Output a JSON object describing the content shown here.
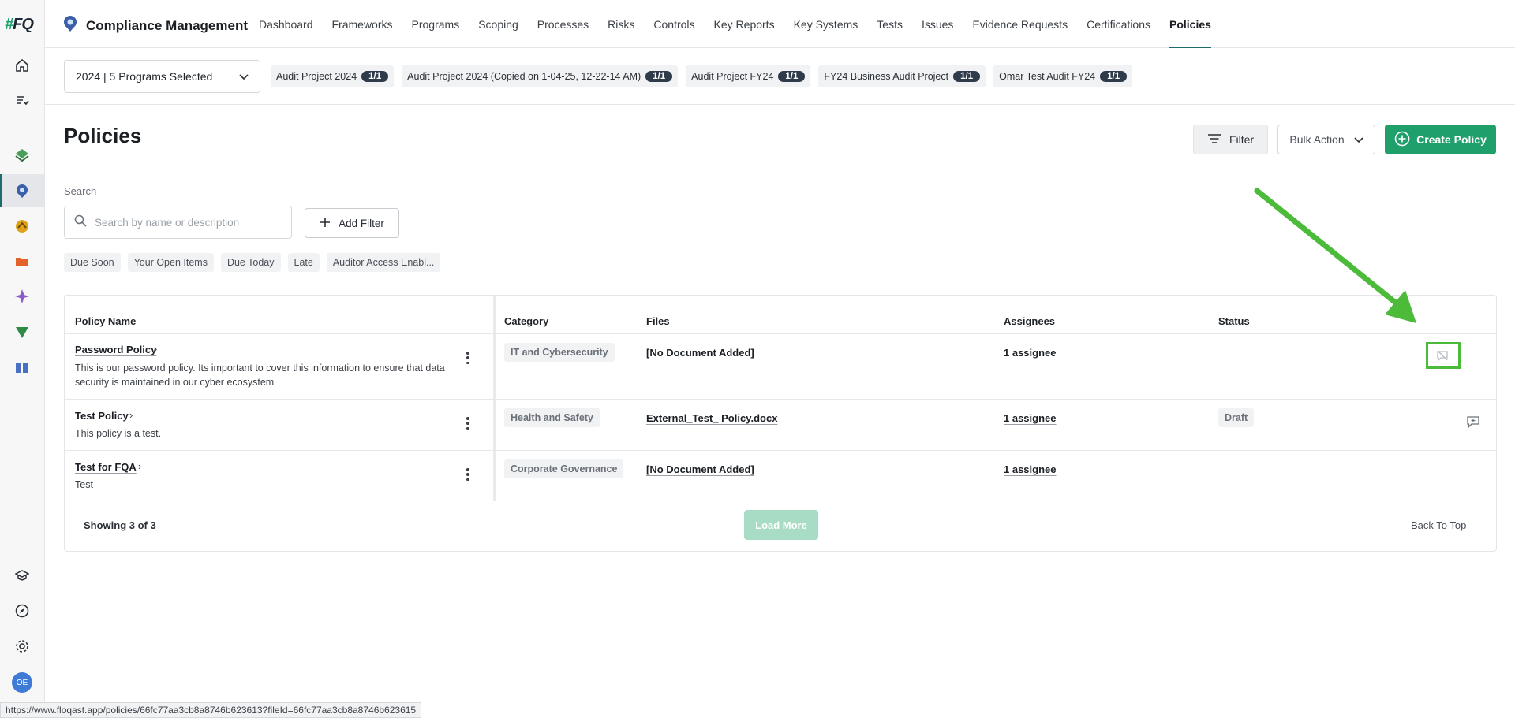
{
  "app": {
    "logo_hash": "#",
    "logo_text": "FQ",
    "title": "Compliance Management"
  },
  "nav": {
    "items": [
      {
        "label": "Dashboard"
      },
      {
        "label": "Frameworks"
      },
      {
        "label": "Programs"
      },
      {
        "label": "Scoping"
      },
      {
        "label": "Processes"
      },
      {
        "label": "Risks"
      },
      {
        "label": "Controls"
      },
      {
        "label": "Key Reports"
      },
      {
        "label": "Key Systems"
      },
      {
        "label": "Tests"
      },
      {
        "label": "Issues"
      },
      {
        "label": "Evidence Requests"
      },
      {
        "label": "Certifications"
      },
      {
        "label": "Policies"
      }
    ],
    "active": "Policies"
  },
  "programs": {
    "selector_label": "2024 | 5 Programs Selected",
    "chips": [
      {
        "label": "Audit Project 2024",
        "count": "1/1"
      },
      {
        "label": "Audit Project 2024 (Copied on 1-04-25, 12-22-14 AM)",
        "count": "1/1"
      },
      {
        "label": "Audit Project FY24",
        "count": "1/1"
      },
      {
        "label": "FY24 Business Audit Project",
        "count": "1/1"
      },
      {
        "label": "Omar Test Audit FY24",
        "count": "1/1"
      }
    ]
  },
  "page": {
    "title": "Policies",
    "filter_label": "Filter",
    "bulk_label": "Bulk Action",
    "create_label": "Create Policy",
    "search_label": "Search",
    "search_placeholder": "Search by name or description",
    "add_filter_label": "Add Filter",
    "quick_filters": [
      "Due Soon",
      "Your Open Items",
      "Due Today",
      "Late",
      "Auditor Access Enabl..."
    ]
  },
  "table": {
    "headers": {
      "name": "Policy Name",
      "category": "Category",
      "files": "Files",
      "assignees": "Assignees",
      "status": "Status"
    },
    "rows": [
      {
        "name": "Password Policy",
        "desc": "This is our password policy. Its important to cover this information to ensure that data security is maintained in our cyber ecosystem",
        "category": "IT and Cybersecurity",
        "file": "[No Document Added]",
        "assignees": "1 assignee",
        "status": "",
        "action_icon": "comment-off-icon"
      },
      {
        "name": "Test Policy",
        "desc": "This policy is a test.",
        "category": "Health and Safety",
        "file": "External_Test_ Policy.docx",
        "assignees": "1 assignee",
        "status": "Draft",
        "action_icon": "add-comment-icon"
      },
      {
        "name": "Test for FQA",
        "desc": "Test",
        "category": "Corporate Governance",
        "file": "[No Document Added]",
        "assignees": "1 assignee",
        "status": "",
        "action_icon": ""
      }
    ],
    "showing": "Showing 3 of 3",
    "load_more": "Load More",
    "back_to_top": "Back To Top"
  },
  "user": {
    "initials": "OE"
  },
  "status_url": "https://www.floqast.app/policies/66fc77aa3cb8a8746b623613?fileId=66fc77aa3cb8a8746b623615",
  "colors": {
    "accent": "#1fa06b",
    "annotation": "#4cbb3a",
    "nav_active": "#1d6b6b"
  }
}
